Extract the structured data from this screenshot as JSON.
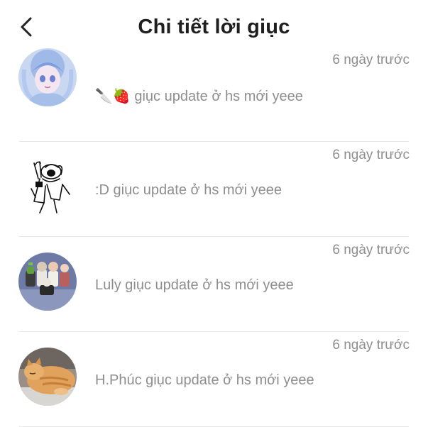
{
  "header": {
    "back_icon": "chevron-left-icon",
    "title": "Chi tiết lời giục"
  },
  "items": [
    {
      "avatar": "anime-blue-hair-avatar",
      "time": "6 ngày trước",
      "message": "🔪🍓 giục update ở hs mới yeee"
    },
    {
      "avatar": "sketch-character-avatar",
      "time": "6 ngày trước",
      "message": ":D giục update ở hs mới yeee"
    },
    {
      "avatar": "toy-figures-avatar",
      "time": "6 ngày trước",
      "message": "Luly giục update ở hs mới yeee"
    },
    {
      "avatar": "orange-cat-avatar",
      "time": "6 ngày trước",
      "message": "H.Phúc giục update ở hs mới yeee"
    }
  ]
}
